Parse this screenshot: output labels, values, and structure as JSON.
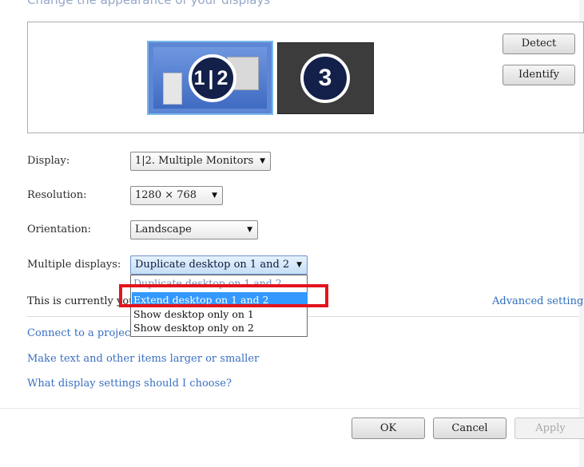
{
  "header": {
    "title": "Change the appearance of your displays"
  },
  "monitors": {
    "selected_label": "1|2",
    "other_label": "3"
  },
  "buttons": {
    "detect": "Detect",
    "identify": "Identify",
    "ok": "OK",
    "cancel": "Cancel",
    "apply": "Apply"
  },
  "fields": {
    "display": {
      "label": "Display:",
      "value": "1|2. Multiple Monitors"
    },
    "resolution": {
      "label": "Resolution:",
      "value": "1280 × 768"
    },
    "orientation": {
      "label": "Orientation:",
      "value": "Landscape"
    },
    "multiple_displays": {
      "label": "Multiple displays:",
      "value": "Duplicate desktop on 1 and 2"
    }
  },
  "dropdown_options": [
    "Duplicate desktop on 1 and 2",
    "Extend desktop on 1 and 2",
    "Show desktop only on 1",
    "Show desktop only on 2"
  ],
  "status": {
    "text": "This is currently you",
    "advanced_link": "Advanced settings"
  },
  "links": [
    "Connect to a projec",
    "Make text and other items larger or smaller",
    "What display settings should I choose?"
  ],
  "colors": {
    "selection": "#3399ff",
    "highlight_box": "#e3141c",
    "link": "#3a6fc2"
  }
}
